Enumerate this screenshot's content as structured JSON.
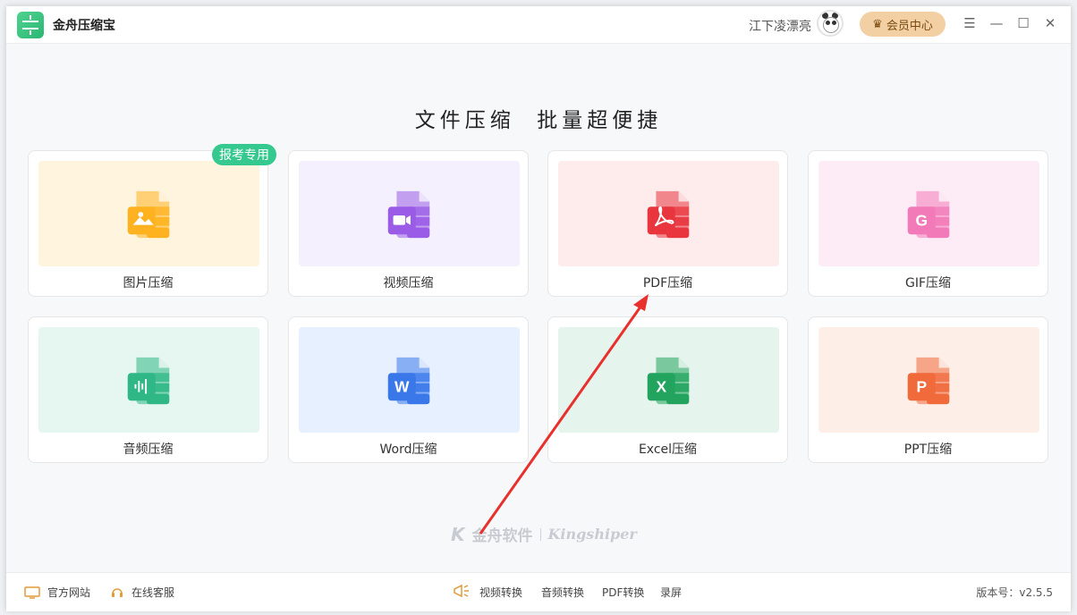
{
  "app": {
    "title": "金舟压缩宝"
  },
  "user": {
    "name": "江下凌漂亮",
    "vip_label": "会员中心"
  },
  "window_controls": [
    "menu-icon",
    "minimize-icon",
    "maximize-icon",
    "close-icon"
  ],
  "headline": "文件压缩  批量超便捷",
  "badge": "报考专用",
  "cards": [
    {
      "label": "图片压缩",
      "icon": "image-file-icon",
      "pane": "#fff4dd",
      "color": "#ffb21f"
    },
    {
      "label": "视频压缩",
      "icon": "video-file-icon",
      "pane": "#f4f0fd",
      "color": "#9a5ce6"
    },
    {
      "label": "PDF压缩",
      "icon": "pdf-file-icon",
      "pane": "#fdeceb",
      "color": "#e8353e"
    },
    {
      "label": "GIF压缩",
      "icon": "gif-file-icon",
      "pane": "#fdebf5",
      "color": "#f27ab8"
    },
    {
      "label": "音频压缩",
      "icon": "audio-file-icon",
      "pane": "#e6f6f0",
      "color": "#2fb886"
    },
    {
      "label": "Word压缩",
      "icon": "word-file-icon",
      "pane": "#e7f0fe",
      "color": "#3a78ea"
    },
    {
      "label": "Excel压缩",
      "icon": "excel-file-icon",
      "pane": "#e5f4ec",
      "color": "#22a45e"
    },
    {
      "label": "PPT压缩",
      "icon": "ppt-file-icon",
      "pane": "#fdeee7",
      "color": "#f06a3c"
    }
  ],
  "watermark": {
    "cn": "金舟软件",
    "en": "Kingshiper"
  },
  "footer": {
    "website": "官方网站",
    "support": "在线客服",
    "links": [
      "视频转换",
      "音频转换",
      "PDF转换",
      "录屏"
    ],
    "version": "版本号：v2.5.5"
  },
  "annotation_color": "#e8302c"
}
